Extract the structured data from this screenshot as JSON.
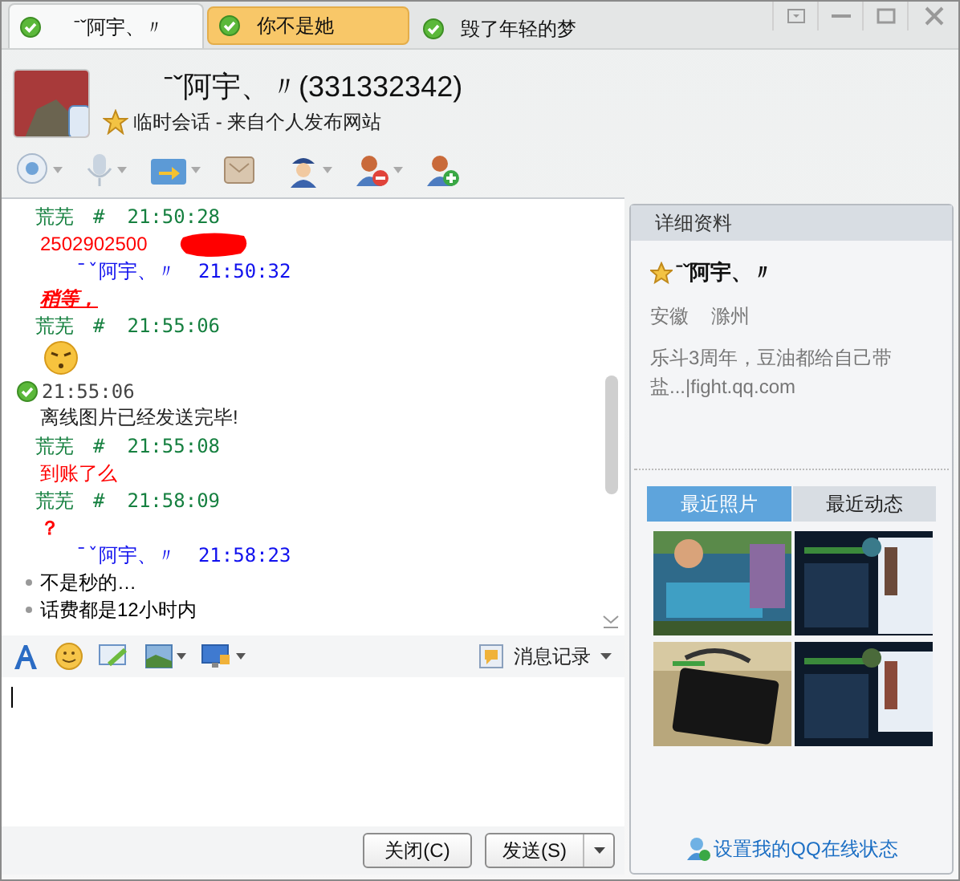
{
  "tabs": [
    {
      "label": "ˉˇ阿宇、〃",
      "selected": true,
      "online": true
    },
    {
      "label": "你不是她",
      "selected": false,
      "highlighted": true,
      "online": true
    },
    {
      "label": "毁了年轻的梦",
      "selected": false,
      "highlighted": false,
      "online": true
    }
  ],
  "contact": {
    "name": "ˉˇ阿宇、〃",
    "number": "(331332342)",
    "session": "临时会话 - 来自个人发布网站"
  },
  "messages": [
    {
      "kind": "header",
      "self": true,
      "sender": "荒芜　#",
      "time": "21:50:28"
    },
    {
      "kind": "text",
      "color": "#ff0000",
      "text": "2502902500",
      "redacted": true
    },
    {
      "kind": "header",
      "self": false,
      "sender": "ˉˇ阿宇、〃",
      "time": "21:50:32"
    },
    {
      "kind": "text",
      "color": "#ff0000",
      "text": "稍等，",
      "emphasis": true
    },
    {
      "kind": "header",
      "self": true,
      "sender": "荒芜　#",
      "time": "21:55:06"
    },
    {
      "kind": "emoji"
    },
    {
      "kind": "system",
      "time": "21:55:06",
      "text": "离线图片已经发送完毕!"
    },
    {
      "kind": "header",
      "self": true,
      "sender": "荒芜　#",
      "time": "21:55:08"
    },
    {
      "kind": "text",
      "color": "#ff0000",
      "text": "到账了么"
    },
    {
      "kind": "header",
      "self": true,
      "sender": "荒芜　#",
      "time": "21:58:09"
    },
    {
      "kind": "text",
      "color": "#ff0000",
      "text": "？",
      "emphasis": false,
      "bold": true
    },
    {
      "kind": "header",
      "self": false,
      "sender": "ˉˇ阿宇、〃",
      "time": "21:58:23"
    },
    {
      "kind": "text",
      "color": "#000000",
      "text": "不是秒的…",
      "bullet": true
    },
    {
      "kind": "text",
      "color": "#000000",
      "text": "话费都是12小时内",
      "bullet": true
    }
  ],
  "history_button": "消息记录",
  "buttons": {
    "close": "关闭(C)",
    "send": "发送(S)"
  },
  "profile": {
    "title": "详细资料",
    "name": "ˉˇ阿宇、〃",
    "province": "安徽",
    "city": "滁州",
    "signature": "乐斗3周年，豆油都给自己带盐...|fight.qq.com"
  },
  "profile_tabs": [
    {
      "label": "最近照片",
      "selected": true
    },
    {
      "label": "最近动态",
      "selected": false
    }
  ],
  "status_link": "设置我的QQ在线状态"
}
